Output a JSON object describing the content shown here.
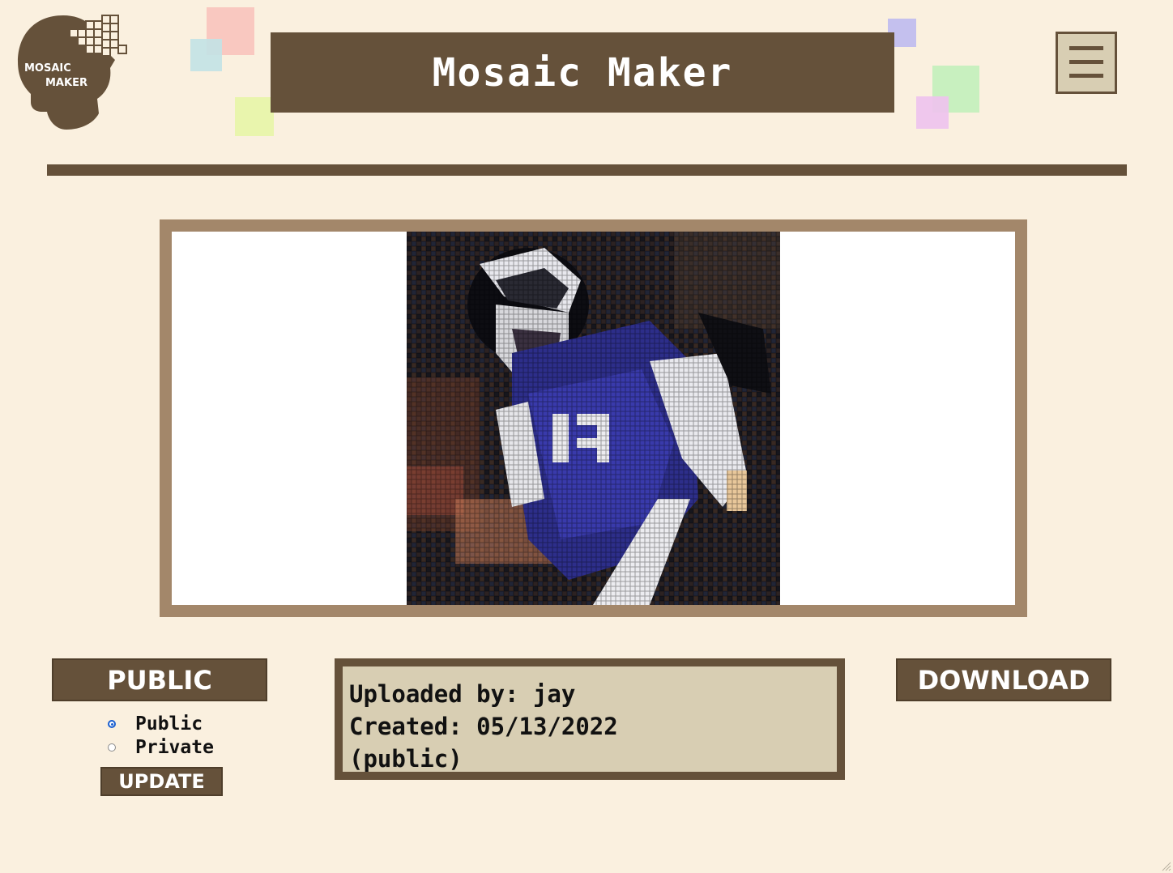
{
  "header": {
    "logo_text_top": "MOSAIC",
    "logo_text_bottom": "MAKER",
    "title": "Mosaic Maker",
    "menu_icon": "hamburger-icon"
  },
  "colors": {
    "background": "#faf0df",
    "brand_brown": "#65513a",
    "frame_tan": "#a3876a",
    "panel_beige": "#d8ceb3",
    "deco_pink": "#f9c8c0",
    "deco_blue": "#c2e2e6",
    "deco_lime": "#e9f5ad",
    "deco_violet": "#c4c0ee",
    "deco_green": "#c8f0bf",
    "deco_magenta": "#eec3ee"
  },
  "mosaic": {
    "alt": "Photo mosaic image"
  },
  "visibility": {
    "badge": "PUBLIC",
    "options": [
      {
        "label": "Public",
        "checked": true
      },
      {
        "label": "Private",
        "checked": false
      }
    ],
    "update_label": "UPDATE"
  },
  "info": {
    "uploaded_line": "Uploaded by: jay",
    "created_line": "Created: 05/13/2022",
    "status_line": "(public)"
  },
  "download_label": "DOWNLOAD"
}
